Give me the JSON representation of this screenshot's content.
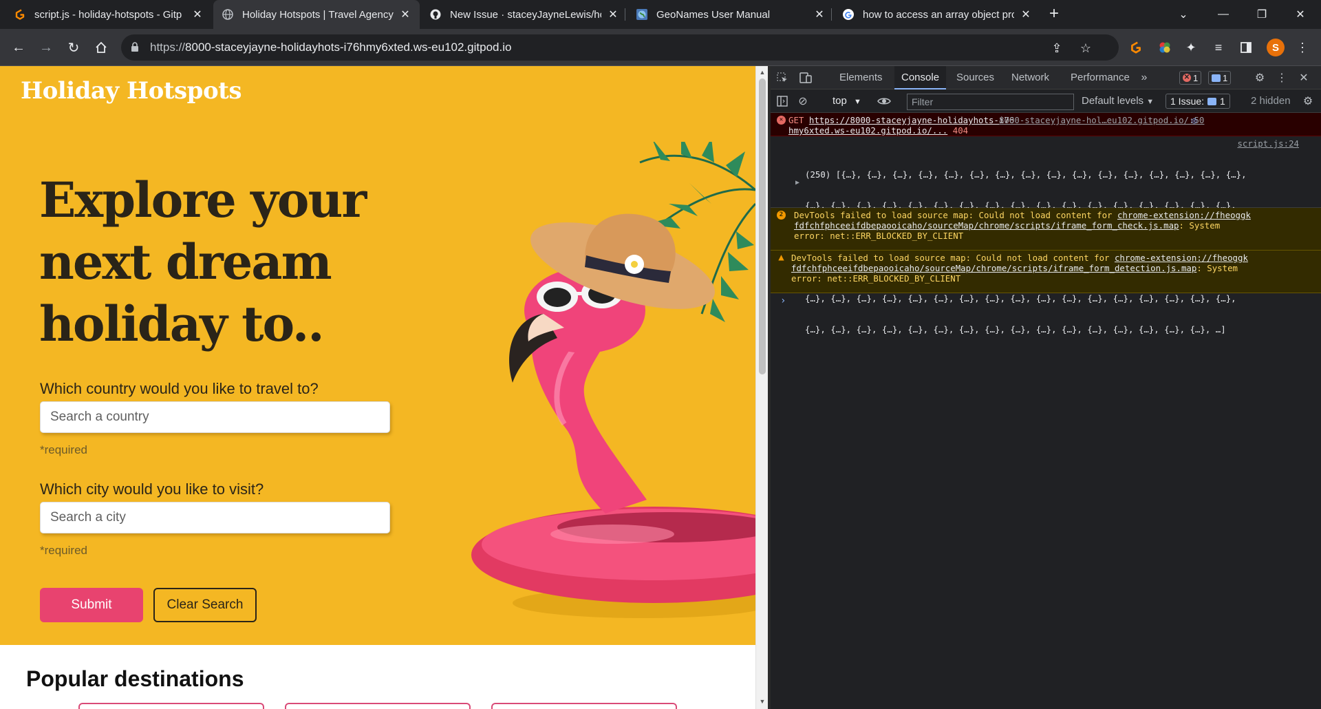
{
  "browser": {
    "tabs": [
      {
        "title": "script.js - holiday-hotspots - Gitp",
        "icon": "gitpod-icon",
        "active": false
      },
      {
        "title": "Holiday Hotspots | Travel Agency",
        "icon": "globe-icon",
        "active": true
      },
      {
        "title": "New Issue · staceyJayneLewis/hol",
        "icon": "github-icon",
        "active": false
      },
      {
        "title": "GeoNames User Manual",
        "icon": "globe-image-icon",
        "active": false
      },
      {
        "title": "how to access an array object pro",
        "icon": "google-icon",
        "active": false
      }
    ],
    "url_prefix": "https://",
    "url_host": "8000-staceyjayne-holidayhots-i76hmy6xted.ws-eu102.gitpod.io",
    "profile_initial": "S",
    "accent": "#e8710a"
  },
  "site": {
    "brand": "Holiday Hotspots",
    "headline_lines": [
      "Explore your",
      "next dream",
      "holiday to.."
    ],
    "country_label": "Which country would you like to travel to?",
    "country_placeholder": "Search a country",
    "city_label": "Which city would you like to visit?",
    "city_placeholder": "Search a city",
    "required_note": "*required",
    "submit_label": "Submit",
    "clear_label": "Clear Search",
    "popular_heading": "Popular destinations",
    "hero_color": "#f4b723",
    "submit_color": "#e8436f"
  },
  "devtools": {
    "tabs": [
      "Elements",
      "Console",
      "Sources",
      "Network",
      "Performance"
    ],
    "active_tab": "Console",
    "error_count": "1",
    "message_count": "1",
    "context": "top",
    "filter_placeholder": "Filter",
    "levels": "Default levels",
    "issues_label": "1 Issue:",
    "issues_count": "1",
    "hidden": "2 hidden",
    "messages": [
      {
        "type": "error",
        "method": "GET",
        "url1": "https://8000-staceyjayne-holidayhots-i76",
        "url2": "hmy6xted.ws-eu102.gitpod.io/...",
        "status": "404",
        "source": "8000-staceyjayne-hol…eu102.gitpod.io/:50"
      },
      {
        "type": "log",
        "source": "script.js:24",
        "lines": [
          "(250) [{…}, {…}, {…}, {…}, {…}, {…}, {…}, {…}, {…}, {…}, {…}, {…}, {…}, {…}, {…}, {…},",
          "{…}, {…}, {…}, {…}, {…}, {…}, {…}, {…}, {…}, {…}, {…}, {…}, {…}, {…}, {…}, {…}, {…},",
          "{…}, {…}, {…}, {…}, {…}, {…}, {…}, {…}, {…}, {…}, {…}, {…}, {…}, {…}, {…}, {…}, {…},",
          "{…}, {…}, {…}, {…}, {…}, {…}, {…}, {…}, {…}, {…}, {…}, {…}, {…}, {…}, {…}, {…}, {…},",
          "{…}, {…}, {…}, {…}, {…}, {…}, {…}, {…}, {…}, {…}, {…}, {…}, {…}, {…}, {…}, {…}, {…},",
          "{…}, {…}, {…}, {…}, {…}, {…}, {…}, {…}, {…}, {…}, {…}, {…}, {…}, {…}, {…}, {…}, …]"
        ]
      },
      {
        "type": "warn",
        "count": "2",
        "prefix": "DevTools failed to load source map: Could not load content for ",
        "link1": "chrome-extension://fheoggk",
        "link2": "fdfchfphceeifdbepaooicaho/sourceMap/chrome/scripts/iframe_form_check.js.map",
        "suffix": ": System",
        "tail": "error: net::ERR_BLOCKED_BY_CLIENT"
      },
      {
        "type": "warn",
        "prefix": "DevTools failed to load source map: Could not load content for ",
        "link1": "chrome-extension://fheoggk",
        "link2": "fdfchfphceeifdbepaooicaho/sourceMap/chrome/scripts/iframe_form_detection.js.map",
        "suffix": ": System",
        "tail": "error: net::ERR_BLOCKED_BY_CLIENT"
      }
    ]
  }
}
